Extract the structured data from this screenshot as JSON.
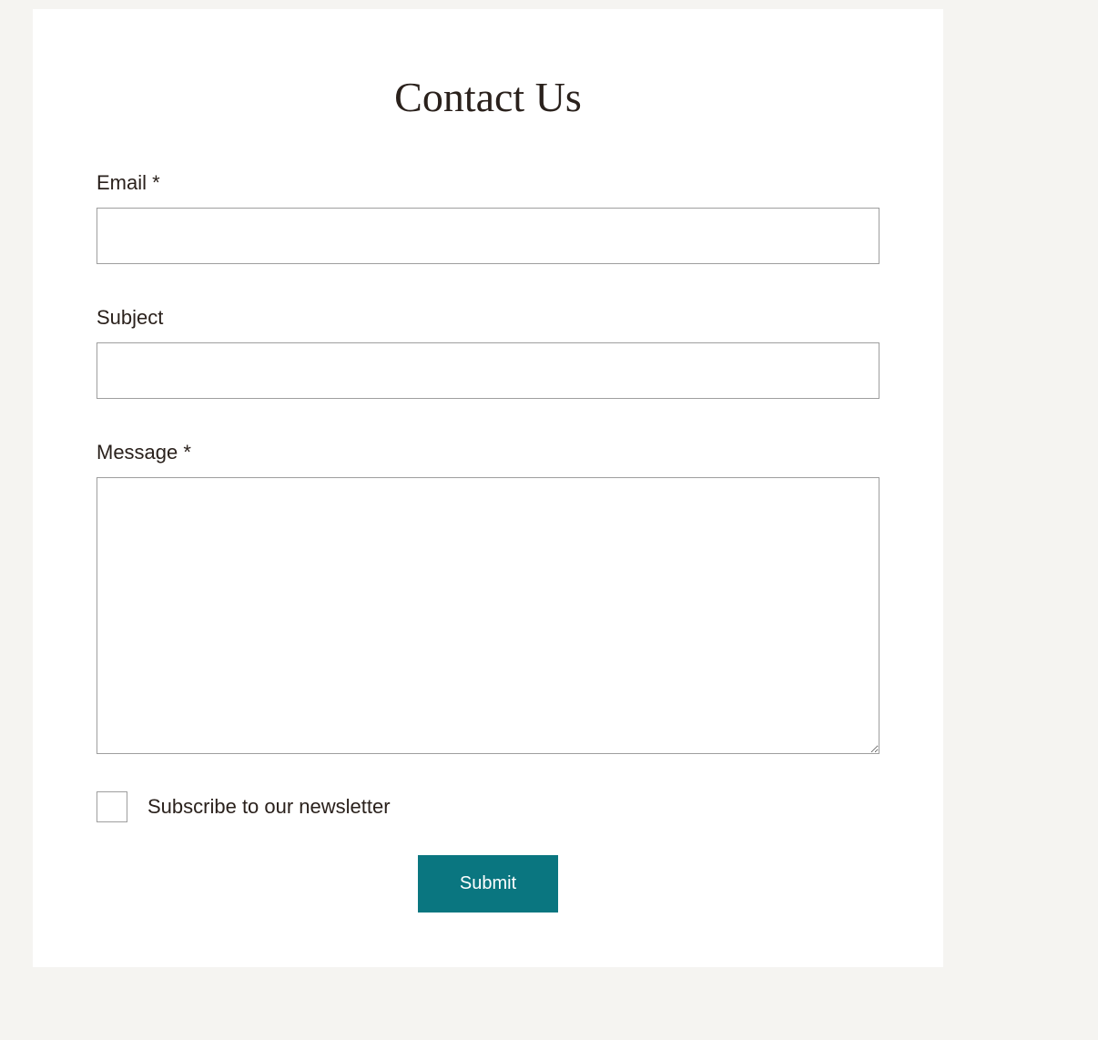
{
  "header": {
    "title": "Contact Us"
  },
  "form": {
    "fields": {
      "email": {
        "label": "Email *",
        "value": "",
        "placeholder": ""
      },
      "subject": {
        "label": "Subject",
        "value": "",
        "placeholder": ""
      },
      "message": {
        "label": "Message *",
        "value": "",
        "placeholder": ""
      }
    },
    "newsletter": {
      "label": "Subscribe to our newsletter",
      "checked": false
    },
    "submit_label": "Submit"
  },
  "colors": {
    "page_bg": "#f5f4f1",
    "card_bg": "#ffffff",
    "text": "#2a211c",
    "border": "#9e9e9e",
    "accent": "#0a7680",
    "accent_text": "#ffffff"
  }
}
